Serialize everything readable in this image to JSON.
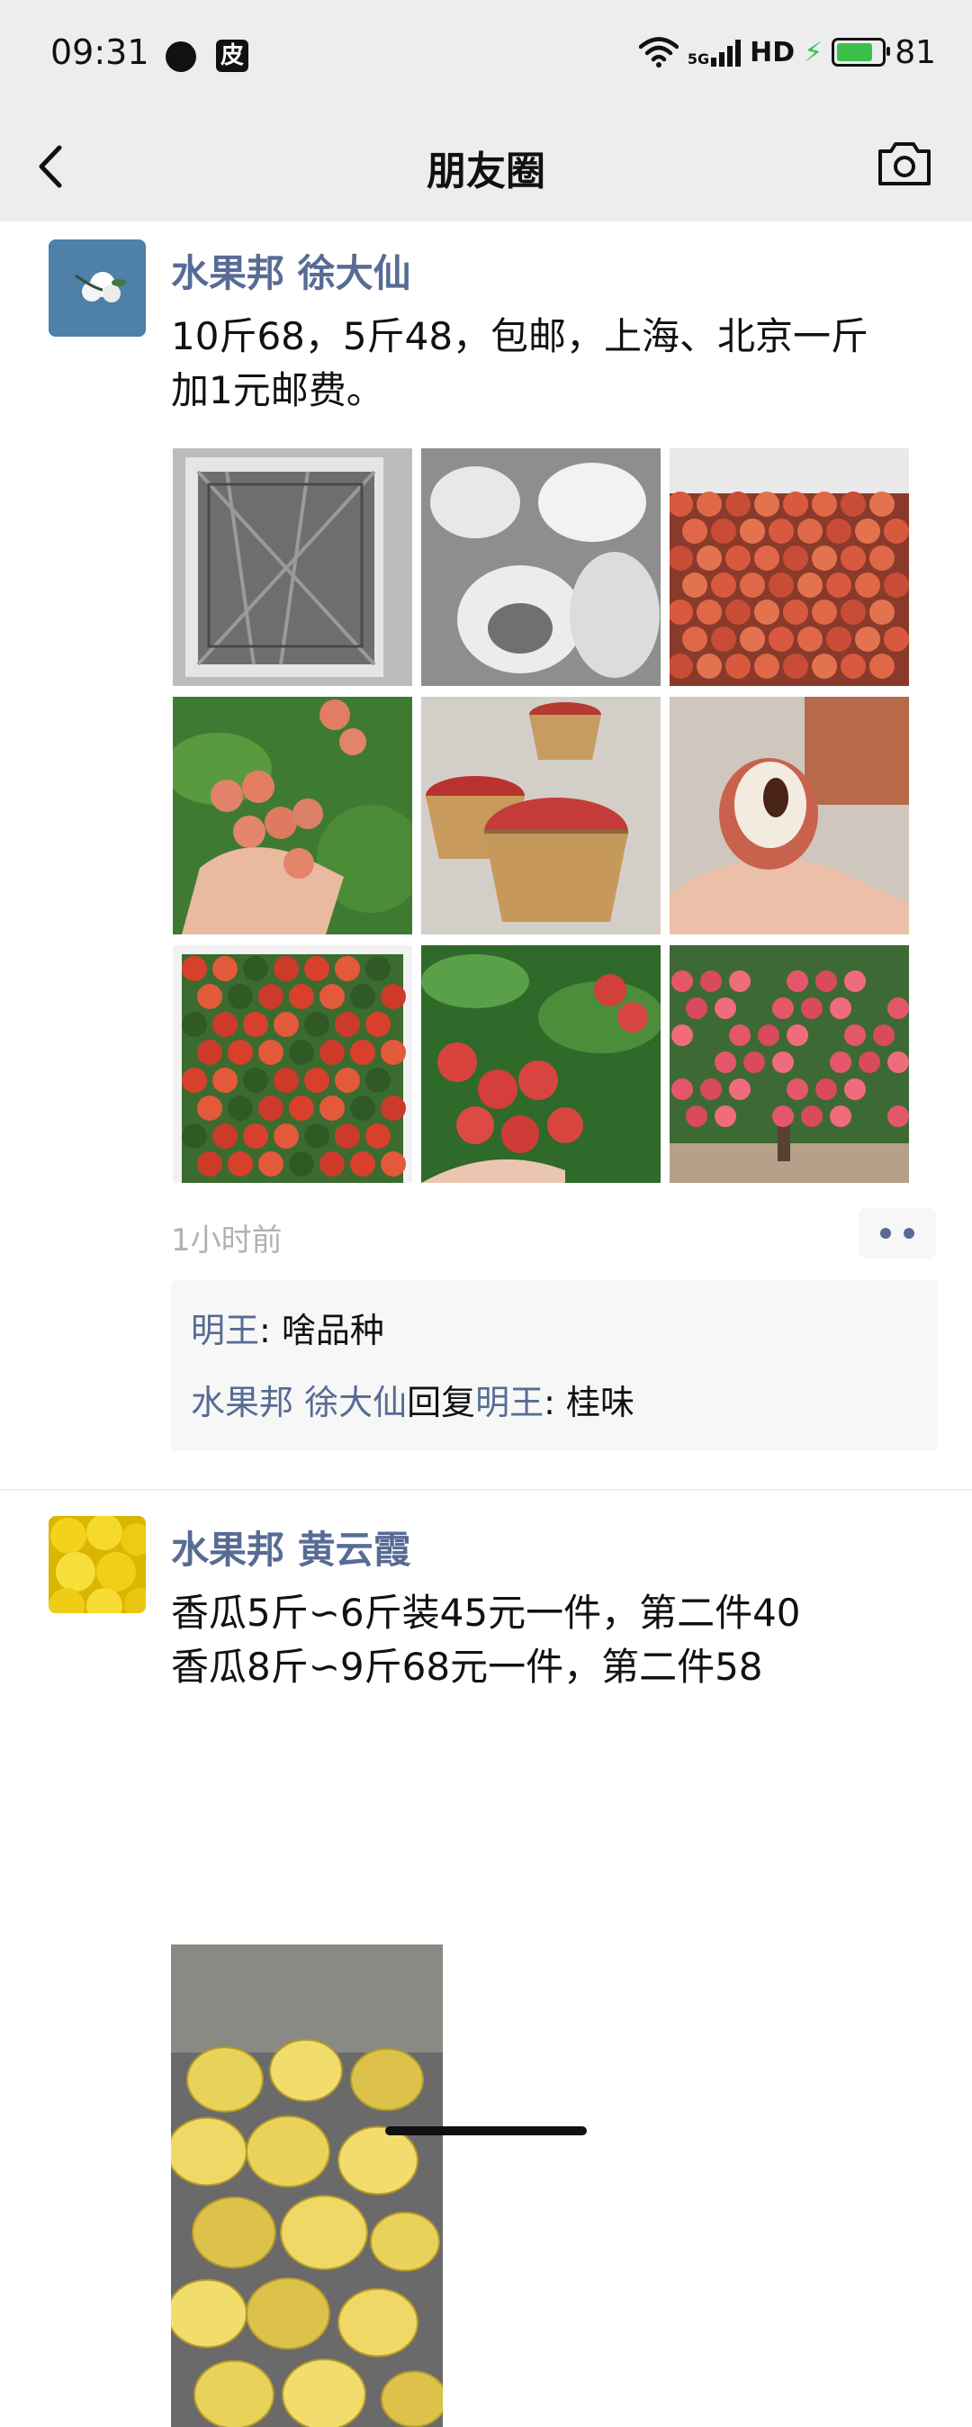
{
  "status_bar": {
    "time": "09:31",
    "app_badge": "皮",
    "network": "5G",
    "hd": "HD",
    "battery": "81",
    "battery_level": 0.81,
    "icons": [
      "chat-bubble-icon",
      "app-icon",
      "wifi-icon",
      "signal-icon",
      "charging-icon",
      "battery-icon"
    ]
  },
  "nav": {
    "title": "朋友圈",
    "back_icon": "back-chevron-icon",
    "camera_icon": "camera-icon"
  },
  "posts": [
    {
      "author": "水果邦 徐大仙",
      "text_lines": [
        "10斤68，5斤48，包邮，上海、北京一斤",
        "加1元邮费。"
      ],
      "images": [
        "foil-lined-box",
        "packing-bags",
        "lychee-box",
        "lychee-in-hand",
        "lychee-baskets",
        "peeled-lychee",
        "lychee-with-leaves",
        "lychee-branch",
        "lychee-tree"
      ],
      "time": "1小时前",
      "comments": [
        {
          "name": "明王",
          "sep": ": ",
          "text": "啥品种"
        },
        {
          "name": "水果邦 徐大仙",
          "reply_word": "回复",
          "reply_to": "明王",
          "sep": ": ",
          "text": "桂味"
        }
      ]
    },
    {
      "author": "水果邦 黄云霞",
      "text_lines": [
        "香瓜5斤∽6斤装45元一件，第二件40",
        "香瓜8斤∽9斤68元一件，第二件58"
      ],
      "images": [
        "yellow-melons"
      ]
    }
  ],
  "colors": {
    "link": "#576b95",
    "bar_bg": "#ededed",
    "comment_bg": "#f7f7f7",
    "time_gray": "#b2b2b2",
    "charge_green": "#3bc04a"
  }
}
